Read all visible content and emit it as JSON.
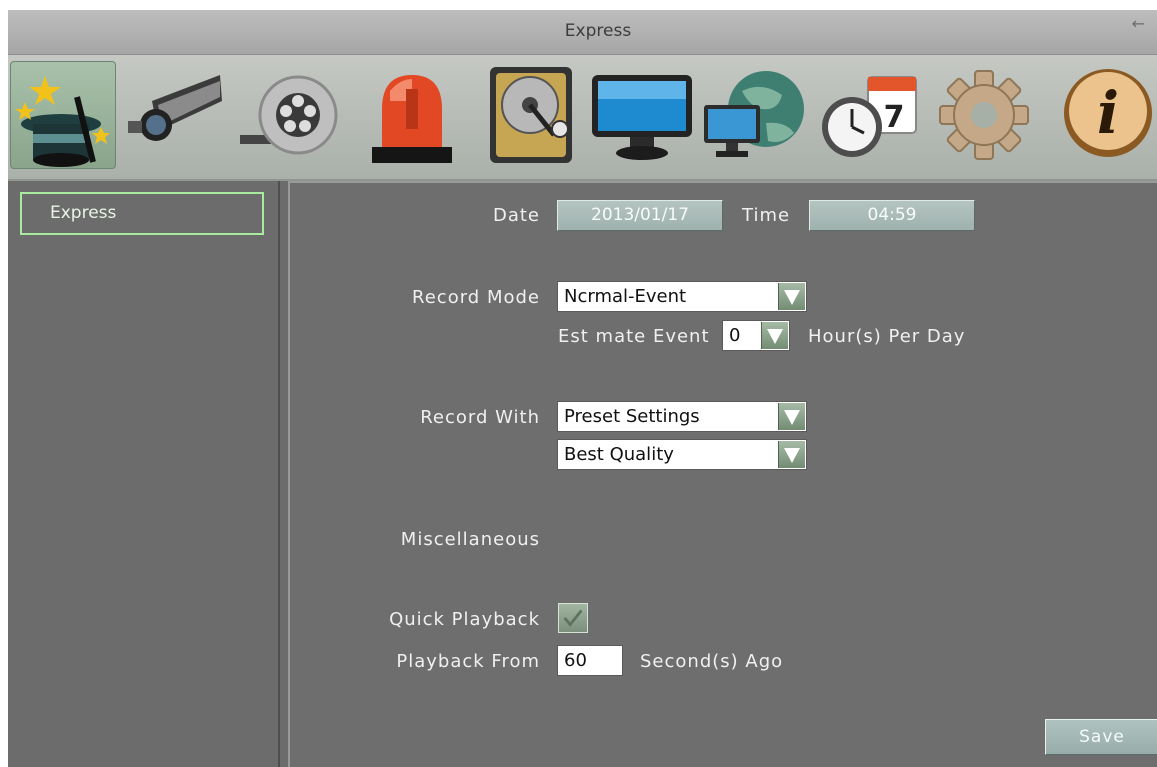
{
  "window": {
    "title": "Express"
  },
  "toolbar": {
    "icons": [
      "magic-hat-icon",
      "camera-icon",
      "film-reel-icon",
      "alarm-light-icon",
      "hard-disk-icon",
      "monitor-icon",
      "network-globe-icon",
      "clock-calendar-icon",
      "gear-icon",
      "info-icon"
    ],
    "calendar_day": "7",
    "info_glyph": "i"
  },
  "sidebar": {
    "items": [
      {
        "label": "Express",
        "selected": true
      }
    ]
  },
  "form": {
    "date_label": "Date",
    "date_value": "2013/01/17",
    "time_label": "Time",
    "time_value": "04:59",
    "record_mode_label": "Record Mode",
    "record_mode_value": "Ncrmal-Event",
    "estimate_label": "Est mate Event",
    "estimate_value": "0",
    "estimate_unit": "Hour(s) Per Day",
    "record_with_label": "Record With",
    "record_with_value": "Preset Settings",
    "quality_value": "Best Quality",
    "misc_label": "Miscellaneous",
    "quick_playback_label": "Quick Playback",
    "quick_playback_checked": true,
    "playback_from_label": "Playback From",
    "playback_from_value": "60",
    "playback_from_unit": "Second(s) Ago",
    "save_label": "Save"
  },
  "colors": {
    "panel_bg": "#6c6c6c",
    "selected_border": "#a9ec9f",
    "title_bar": "#b3b3b3"
  }
}
